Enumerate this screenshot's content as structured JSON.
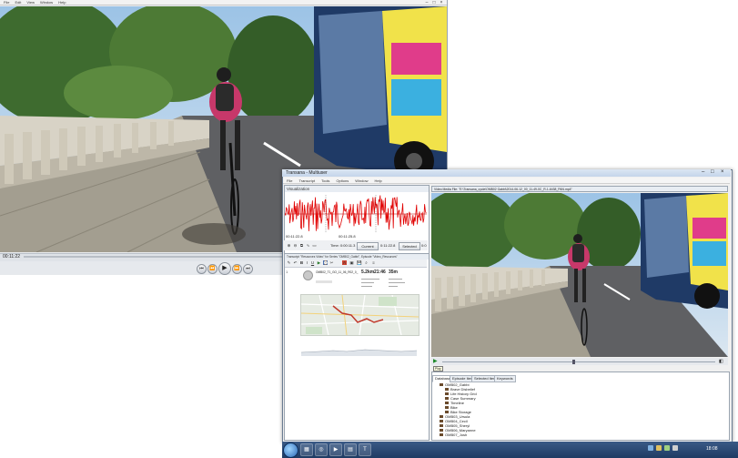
{
  "left_player": {
    "menu": [
      "File",
      "Edit",
      "View",
      "Window",
      "Help"
    ],
    "time": "00:11:22",
    "controls": [
      "⏮",
      "⏪",
      "▶",
      "⏩",
      "⏭"
    ]
  },
  "transana": {
    "title": "Transana - Multiuser",
    "menu": [
      "File",
      "Transcript",
      "Tools",
      "Options",
      "Window",
      "Help"
    ],
    "visualization": {
      "header": "Visualization",
      "time_start": "00:11:22.8",
      "time_end": "00:11:25.8",
      "time_value": "Time: 0:00:11.3",
      "current_label": "Current",
      "selected_value": "0:11:22.8",
      "selected_label": "Selected",
      "end_value": "0:0"
    },
    "transcript": {
      "header": "Transcript \"Resources Video\" for Series \"OMB02_Gabbi\", Episode \"Video_Resources\"",
      "line_no": "1",
      "file_label": "OMB02_T1_GO_11_06_R02_0_",
      "stats": [
        "5.2km",
        "21:46",
        "35m"
      ]
    },
    "video_header": "Video Media File: \"E:\\Transana_cycle\\OMB02 Gabbi\\2014-06-12_00_11-49-0C_R-1-6438_PAN.mp4\"",
    "database": {
      "tabs": [
        "Database",
        "Episode Items",
        "Selected Items",
        "Keywords"
      ],
      "tree": [
        "OMB02_Gabbi",
        "Brave Disbelief",
        "Life History Grid",
        "Case Summary",
        "Timeline",
        "Bike",
        "Bike Storage",
        "OMB03_Ursula",
        "OMB04_Cecil",
        "OMB05_Sheryl",
        "OMB06_Maryanne",
        "OMB07_Josh"
      ],
      "tooltip": "Play"
    }
  },
  "taskbar": {
    "clock": "18:08"
  }
}
